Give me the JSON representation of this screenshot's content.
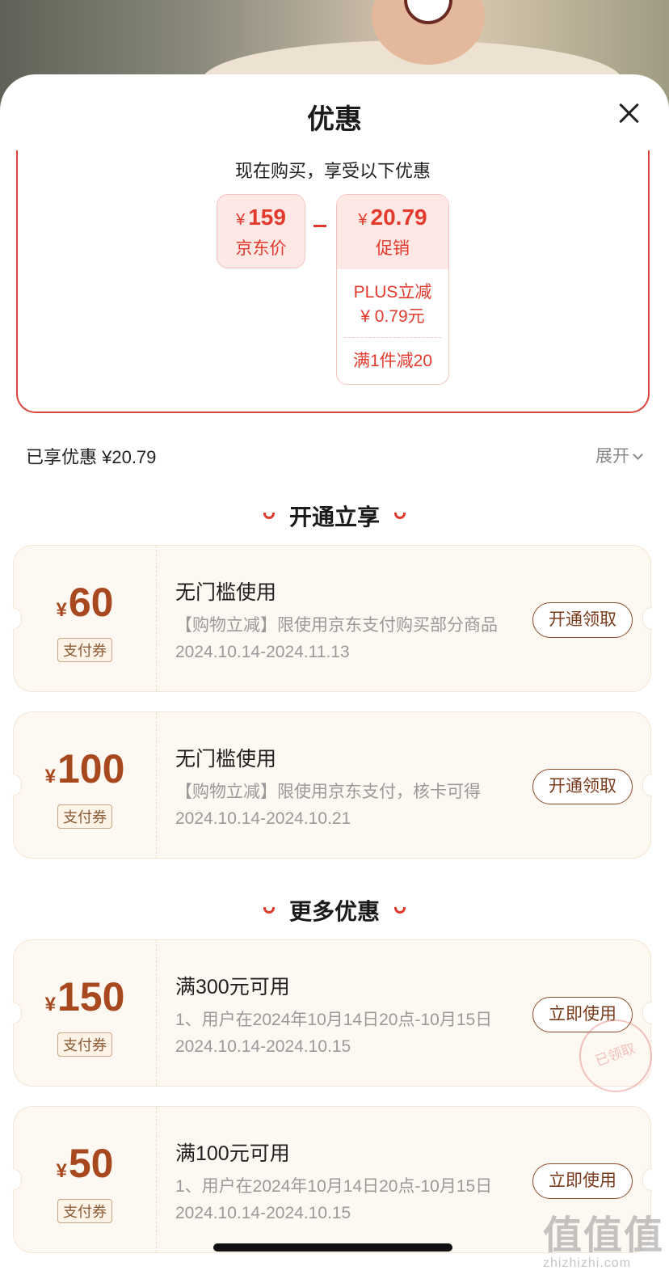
{
  "sheet": {
    "title": "优惠",
    "close_icon": "close-icon"
  },
  "promo": {
    "heading": "现在购买，享受以下优惠",
    "jd_price": {
      "currency": "¥",
      "amount": "159",
      "label": "京东价"
    },
    "minus": "－",
    "promotion": {
      "currency": "¥",
      "amount": "20.79",
      "label": "促销",
      "plus_line1": "PLUS立减",
      "plus_line2": "¥ 0.79元",
      "full_reduce": "满1件减20"
    }
  },
  "summary": {
    "enjoyed": "已享优惠 ¥20.79",
    "expand": "展开"
  },
  "sections": {
    "open_enjoy": "开通立享",
    "more_offers": "更多优惠"
  },
  "coupons": [
    {
      "currency": "¥",
      "value": "60",
      "tag": "支付券",
      "title": "无门槛使用",
      "desc": "【购物立减】限使用京东支付购买部分商品",
      "date": "2024.10.14-2024.11.13",
      "button": "开通领取"
    },
    {
      "currency": "¥",
      "value": "100",
      "tag": "支付券",
      "title": "无门槛使用",
      "desc": "【购物立减】限使用京东支付，核卡可得",
      "date": "2024.10.14-2024.10.21",
      "button": "开通领取"
    },
    {
      "currency": "¥",
      "value": "150",
      "tag": "支付券",
      "title": "满300元可用",
      "desc": "1、用户在2024年10月14日20点-10月15日",
      "date": "2024.10.14-2024.10.15",
      "button": "立即使用",
      "stamp": "已领取"
    },
    {
      "currency": "¥",
      "value": "50",
      "tag": "支付券",
      "title": "满100元可用",
      "desc": "1、用户在2024年10月14日20点-10月15日",
      "date": "2024.10.14-2024.10.15",
      "button": "立即使用"
    }
  ],
  "watermark": {
    "big": "值值值",
    "small": "zhizhizhi.com"
  },
  "colors": {
    "accent_red": "#e23b2e",
    "coupon_brown": "#a8481e",
    "coupon_bg": "#fdf8f1"
  }
}
